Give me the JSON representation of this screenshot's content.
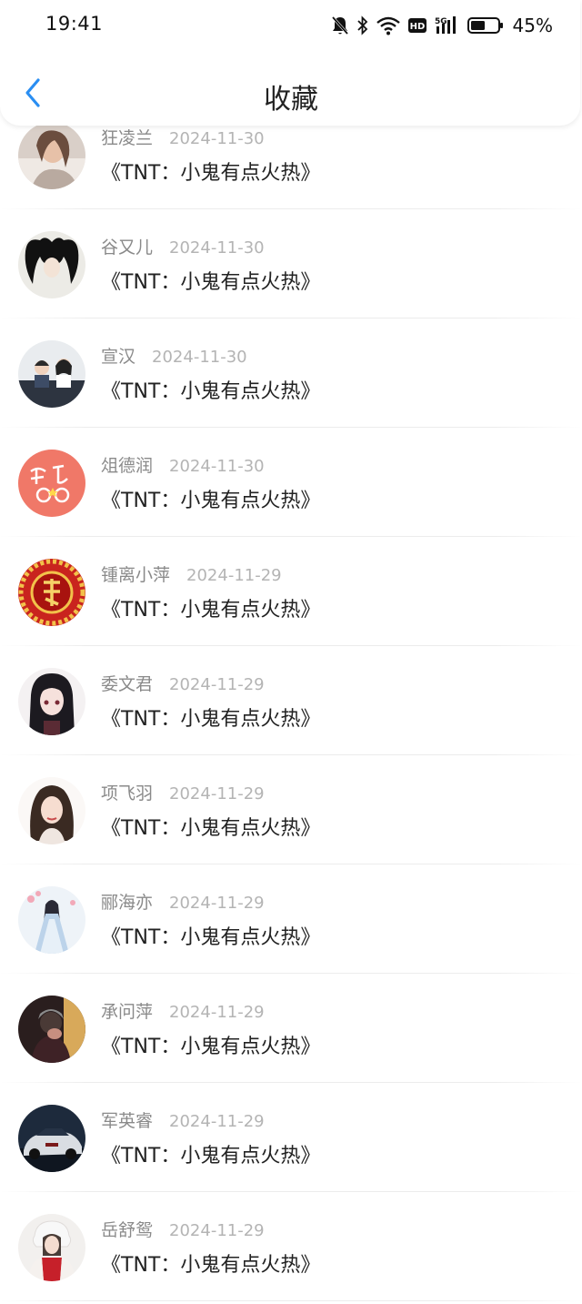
{
  "status_bar": {
    "time": "19:41",
    "battery_percent": "45%",
    "icons": [
      "mute-icon",
      "bluetooth-icon",
      "wifi-icon",
      "hd-icon",
      "5g-signal-icon",
      "battery-icon"
    ]
  },
  "header": {
    "back_icon": "chevron-left-icon",
    "title": "收藏"
  },
  "accent_color": "#2a8ef2",
  "items": [
    {
      "name": "狂凌兰",
      "date": "2024-11-30",
      "title": "《TNT：小鬼有点火热》",
      "avatar": "woman-portrait"
    },
    {
      "name": "谷又儿",
      "date": "2024-11-30",
      "title": "《TNT：小鬼有点火热》",
      "avatar": "dark-hair-cartoon"
    },
    {
      "name": "宣汉",
      "date": "2024-11-30",
      "title": "《TNT：小鬼有点火热》",
      "avatar": "two-kids"
    },
    {
      "name": "俎德润",
      "date": "2024-11-30",
      "title": "《TNT：小鬼有点火热》",
      "avatar": "pink-calligraphy"
    },
    {
      "name": "锺离小萍",
      "date": "2024-11-29",
      "title": "《TNT：小鬼有点火热》",
      "avatar": "red-fu-emblem"
    },
    {
      "name": "委文君",
      "date": "2024-11-29",
      "title": "《TNT：小鬼有点火热》",
      "avatar": "anime-girl"
    },
    {
      "name": "项飞羽",
      "date": "2024-11-29",
      "title": "《TNT：小鬼有点火热》",
      "avatar": "illustrated-woman"
    },
    {
      "name": "郦海亦",
      "date": "2024-11-29",
      "title": "《TNT：小鬼有点火热》",
      "avatar": "ancient-style-figure"
    },
    {
      "name": "承问萍",
      "date": "2024-11-29",
      "title": "《TNT：小鬼有点火热》",
      "avatar": "dark-photo-person"
    },
    {
      "name": "军英睿",
      "date": "2024-11-29",
      "title": "《TNT：小鬼有点火热》",
      "avatar": "sports-car"
    },
    {
      "name": "岳舒鸳",
      "date": "2024-11-29",
      "title": "《TNT：小鬼有点火热》",
      "avatar": "winter-girl"
    }
  ]
}
